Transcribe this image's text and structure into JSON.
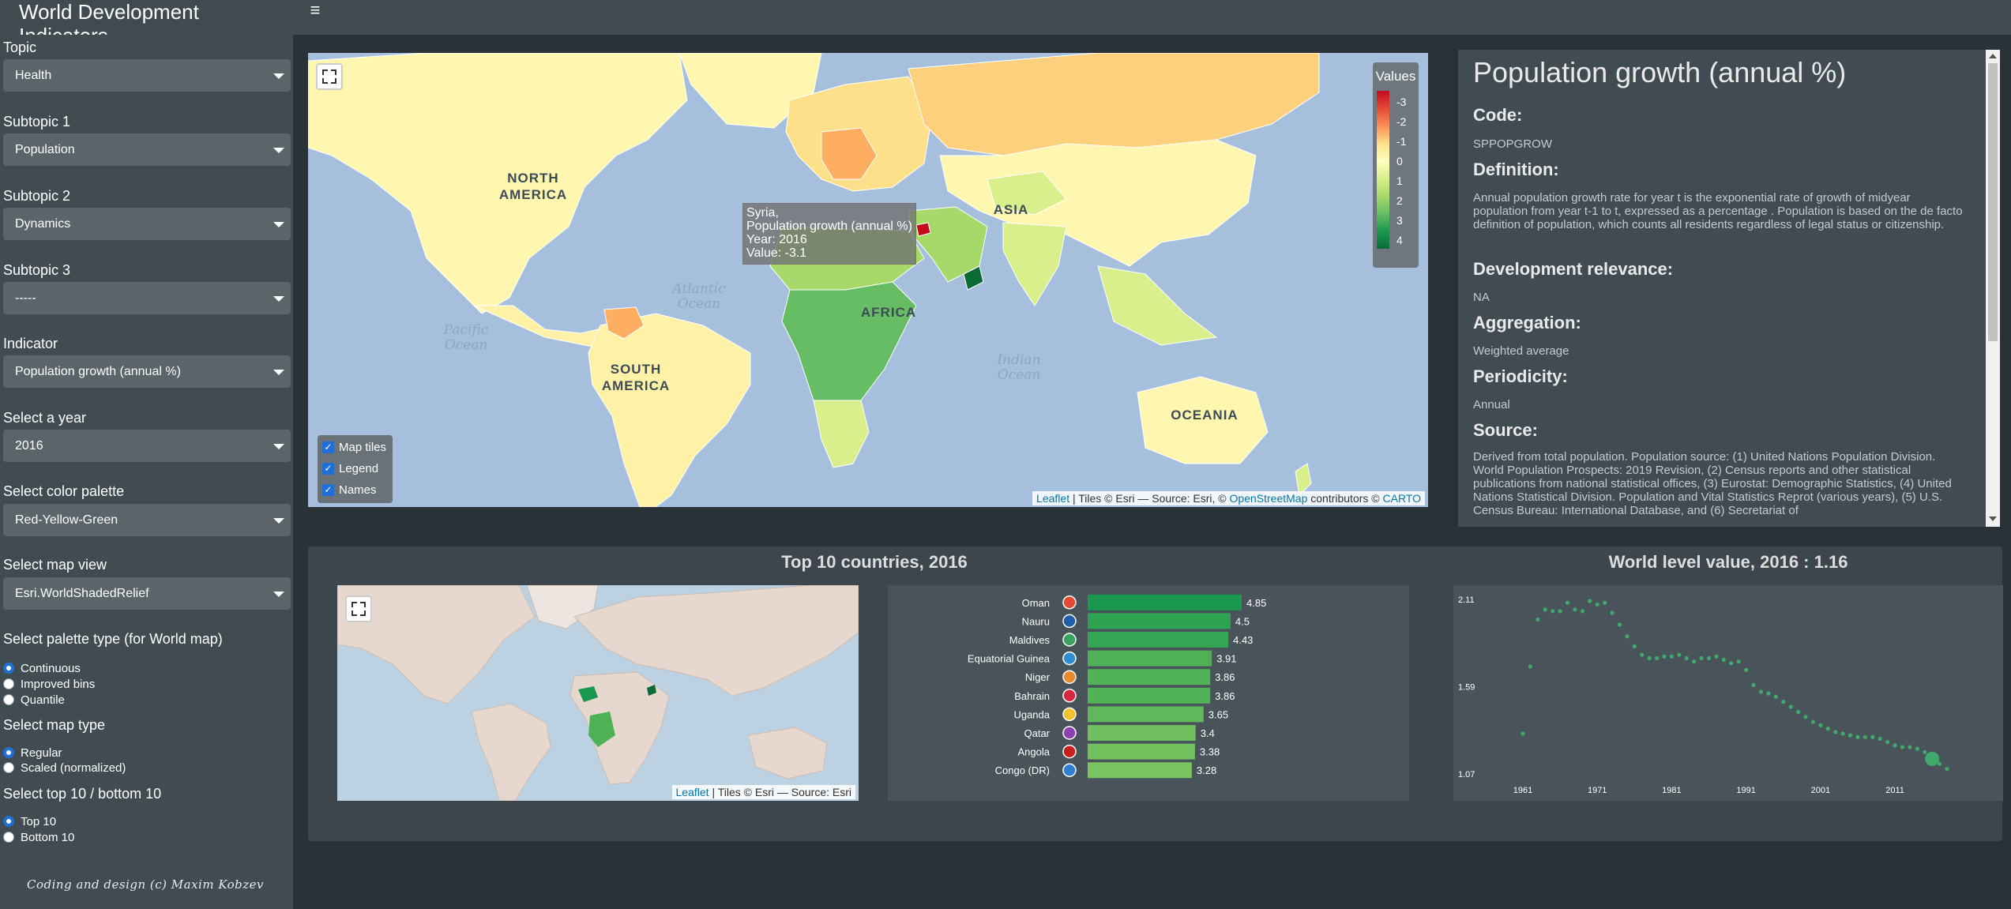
{
  "header": {
    "title": "World Development Indicators",
    "menu_icon": "≡"
  },
  "sidebar": {
    "topic": {
      "label": "Topic",
      "value": "Health"
    },
    "subtopic1": {
      "label": "Subtopic 1",
      "value": "Population"
    },
    "subtopic2": {
      "label": "Subtopic 2",
      "value": "Dynamics"
    },
    "subtopic3": {
      "label": "Subtopic 3",
      "value": "-----"
    },
    "indicator": {
      "label": "Indicator",
      "value": "Population growth (annual %)"
    },
    "year": {
      "label": "Select a year",
      "value": "2016"
    },
    "palette": {
      "label": "Select color palette",
      "value": "Red-Yellow-Green"
    },
    "map_view": {
      "label": "Select map view",
      "value": "Esri.WorldShadedRelief"
    },
    "palette_type": {
      "label": "Select palette type (for World map)",
      "options": [
        "Continuous",
        "Improved bins",
        "Quantile"
      ],
      "selected": "Continuous"
    },
    "map_type": {
      "label": "Select map type",
      "options": [
        "Regular",
        "Scaled (normalized)"
      ],
      "selected": "Regular"
    },
    "top_bottom": {
      "label": "Select top 10 / bottom 10",
      "options": [
        "Top 10",
        "Bottom 10"
      ],
      "selected": "Top 10"
    },
    "credit": "Coding and design (c) Maxim Kobzev"
  },
  "world_map": {
    "labels": {
      "north_america": "NORTH AMERICA",
      "south_america": "SOUTH AMERICA",
      "asia": "ASIA",
      "africa": "AFRICA",
      "oceania": "OCEANIA"
    },
    "oceans": {
      "atlantic": "Atlantic Ocean",
      "pacific": "Pacific Ocean",
      "indian": "Indian Ocean"
    },
    "tooltip": {
      "country": "Syria,",
      "indicator": "Population growth (annual %)",
      "year": "Year: 2016",
      "value": "Value: -3.1"
    },
    "legend": {
      "title": "Values",
      "ticks": [
        "-3",
        "-2",
        "-1",
        "0",
        "1",
        "2",
        "3",
        "4"
      ]
    },
    "layers": [
      "Map tiles",
      "Legend",
      "Names"
    ],
    "attribution": {
      "leaflet": "Leaflet",
      "tiles": " | Tiles © Esri — Source: Esri, © ",
      "osm": "OpenStreetMap",
      "contrib": " contributors © ",
      "carto": "CARTO"
    }
  },
  "info": {
    "title": "Population growth (annual %)",
    "code_h": "Code:",
    "code": "SPPOPGROW",
    "definition_h": "Definition:",
    "definition": "Annual population growth rate for year t is the exponential rate of growth of midyear population from year t-1 to t, expressed as a percentage . Population is based on the de facto definition of population, which counts all residents regardless of legal status or citizenship.",
    "relevance_h": "Development relevance:",
    "relevance": "NA",
    "aggregation_h": "Aggregation:",
    "aggregation": "Weighted average",
    "periodicity_h": "Periodicity:",
    "periodicity": "Annual",
    "source_h": "Source:",
    "source": "Derived from total population. Population source: (1) United Nations Population Division. World Population Prospects: 2019 Revision, (2) Census reports and other statistical publications from national statistical offices, (3) Eurostat: Demographic Statistics, (4) United Nations Statistical Division. Population and Vital Statistics Reprot (various years), (5) U.S. Census Bureau: International Database, and (6) Secretariat of"
  },
  "bottom": {
    "top10_title": "Top 10 countries, 2016",
    "world_title": "World level value, 2016 : 1.16",
    "mini_map_attribution": {
      "leaflet": "Leaflet",
      "rest": " | Tiles © Esri — Source: Esri"
    }
  },
  "chart_data": [
    {
      "type": "bar",
      "categories": [
        "Oman",
        "Nauru",
        "Maldives",
        "Equatorial Guinea",
        "Niger",
        "Bahrain",
        "Uganda",
        "Qatar",
        "Angola",
        "Congo (DR)"
      ],
      "values": [
        4.85,
        4.5,
        4.43,
        3.91,
        3.86,
        3.86,
        3.65,
        3.4,
        3.38,
        3.28
      ],
      "value_labels": [
        "4.85",
        "4.5",
        "4.43",
        "3.91",
        "3.86",
        "3.86",
        "3.65",
        "3.4",
        "3.38",
        "3.28"
      ],
      "bar_colors": [
        "#1a9850",
        "#2ea352",
        "#33a653",
        "#4fb155",
        "#52b356",
        "#52b356",
        "#5fb85a",
        "#70bf5e",
        "#72c05e",
        "#79c360"
      ],
      "orientation": "horizontal"
    },
    {
      "type": "scatter",
      "x": [
        1961,
        1962,
        1963,
        1964,
        1965,
        1966,
        1967,
        1968,
        1969,
        1970,
        1971,
        1972,
        1973,
        1974,
        1975,
        1976,
        1977,
        1978,
        1979,
        1980,
        1981,
        1982,
        1983,
        1984,
        1985,
        1986,
        1987,
        1988,
        1989,
        1990,
        1991,
        1992,
        1993,
        1994,
        1995,
        1996,
        1997,
        1998,
        1999,
        2000,
        2001,
        2002,
        2003,
        2004,
        2005,
        2006,
        2007,
        2008,
        2009,
        2010,
        2011,
        2012,
        2013,
        2014,
        2015,
        2016,
        2017,
        2018
      ],
      "y": [
        1.31,
        1.71,
        1.99,
        2.05,
        2.04,
        2.04,
        2.09,
        2.05,
        2.04,
        2.1,
        2.08,
        2.09,
        2.03,
        1.96,
        1.89,
        1.83,
        1.78,
        1.76,
        1.76,
        1.77,
        1.77,
        1.78,
        1.76,
        1.74,
        1.76,
        1.76,
        1.77,
        1.75,
        1.73,
        1.74,
        1.69,
        1.6,
        1.56,
        1.55,
        1.53,
        1.5,
        1.47,
        1.44,
        1.41,
        1.38,
        1.36,
        1.34,
        1.32,
        1.31,
        1.3,
        1.29,
        1.29,
        1.29,
        1.28,
        1.26,
        1.24,
        1.23,
        1.23,
        1.22,
        1.2,
        1.16,
        1.13,
        1.1
      ],
      "highlight_x": 2016,
      "color": "#3fa86a",
      "x_ticks": [
        "1961",
        "1971",
        "1981",
        "1991",
        "2001",
        "2011"
      ],
      "y_ticks": [
        "2.11",
        "1.59",
        "1.07"
      ],
      "ylim": [
        1.07,
        2.11
      ]
    }
  ]
}
